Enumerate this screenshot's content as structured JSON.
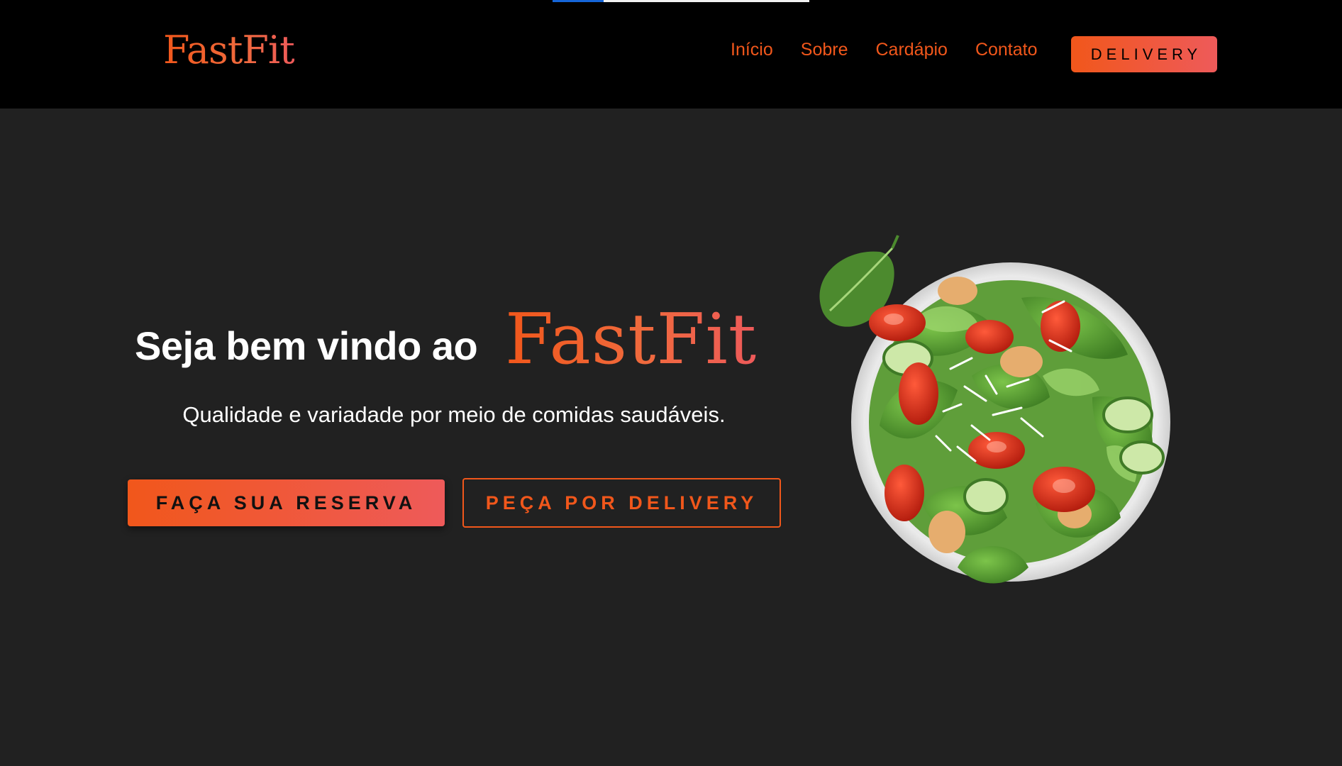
{
  "loading_bar": {
    "progress": 0.2
  },
  "header": {
    "logo": "FastFit",
    "nav": [
      {
        "label": "Início"
      },
      {
        "label": "Sobre"
      },
      {
        "label": "Cardápio"
      },
      {
        "label": "Contato"
      }
    ],
    "delivery_label": "DELIVERY"
  },
  "hero": {
    "title": "Seja bem vindo ao",
    "brand": "FastFit",
    "subtitle": "Qualidade e variadade por meio de comidas saudáveis.",
    "reserve_label": "FAÇA SUA RESERVA",
    "delivery_label": "PEÇA POR DELIVERY",
    "image_icon": "salad-bowl-image"
  },
  "colors": {
    "accent": "#f1571b",
    "accent_end": "#ee5a5a",
    "header_bg": "#000000",
    "page_bg": "#212121",
    "loading_bar": "#1565d8"
  }
}
